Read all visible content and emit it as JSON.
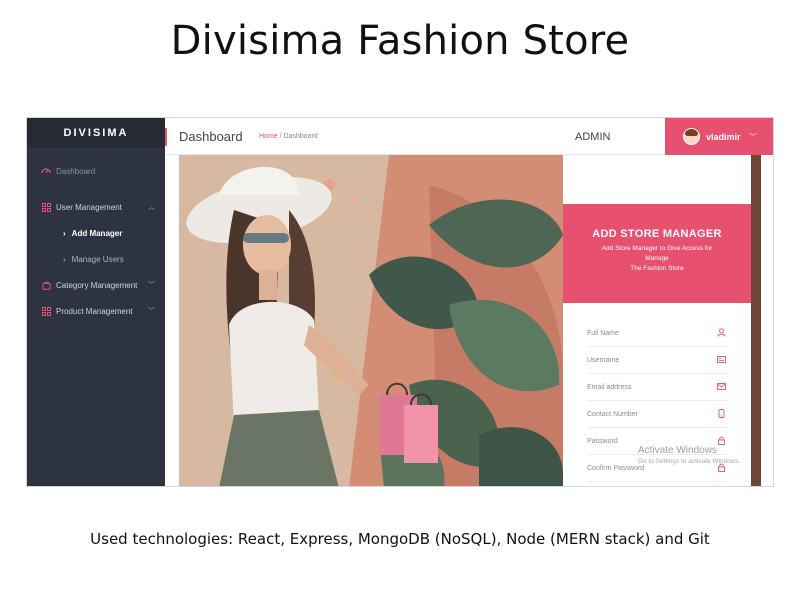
{
  "slide": {
    "title": "Divisima Fashion Store",
    "caption": "Used technologies: React, Express, MongoDB (NoSQL), Node (MERN stack) and Git"
  },
  "sidebar": {
    "brand": "DIVISIMA",
    "items": [
      {
        "label": "Dashboard",
        "icon": "dashboard-icon"
      },
      {
        "label": "User Management",
        "icon": "users-grid-icon"
      },
      {
        "label": "Add Manager"
      },
      {
        "label": "Manage Users"
      },
      {
        "label": "Category Management",
        "icon": "category-icon"
      },
      {
        "label": "Product Management",
        "icon": "product-icon"
      }
    ]
  },
  "header": {
    "title": "Dashboard",
    "breadcrumb_home": "Home",
    "breadcrumb_current": "/ Dashboard",
    "role": "ADMIN",
    "username": "vladimir"
  },
  "form": {
    "title": "ADD STORE MANAGER",
    "subtitle_line1": "Add Store Manager to Give Access for",
    "subtitle_line2": "Manage",
    "subtitle_line3": "The Fashion Store",
    "fields": [
      {
        "placeholder": "Full Name",
        "icon": "user-icon"
      },
      {
        "placeholder": "Username",
        "icon": "id-card-icon"
      },
      {
        "placeholder": "Email address",
        "icon": "envelope-icon"
      },
      {
        "placeholder": "Contact Number",
        "icon": "phone-icon"
      },
      {
        "placeholder": "Password",
        "icon": "lock-icon"
      },
      {
        "placeholder": "Confirm Password",
        "icon": "lock-icon"
      }
    ]
  },
  "watermark": {
    "line1": "Activate Windows",
    "line2": "Go to Settings to activate Windows."
  },
  "colors": {
    "accent": "#e8506f",
    "sidebar": "#2d3340"
  }
}
